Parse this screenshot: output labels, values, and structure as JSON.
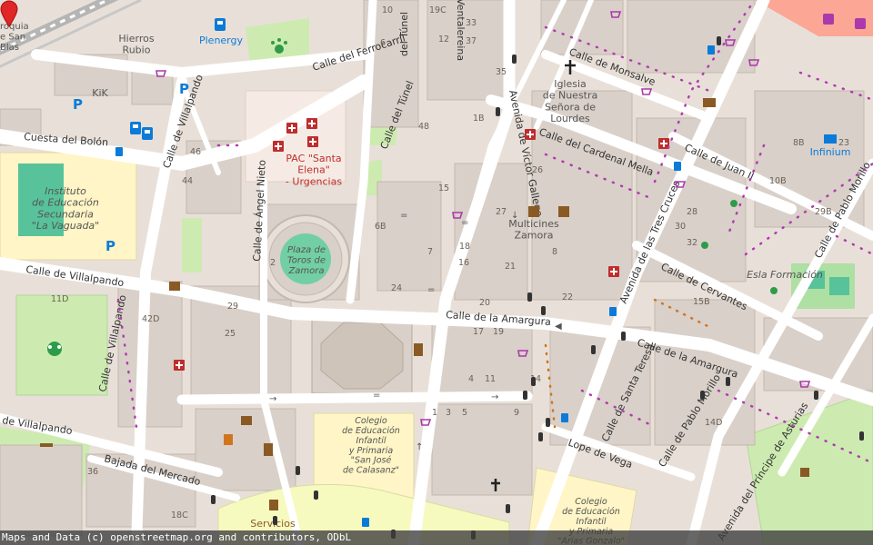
{
  "map": {
    "attribution": "Maps and Data (c) openstreetmap.org and contributors, ODbL",
    "colors": {
      "land": "#e8e0d8",
      "road": "#ffffff",
      "road_edge": "#d6cfc6",
      "building": "#d9d0c9",
      "building_edge": "#c4b8ad",
      "school": "#fff5c6",
      "park": "#cdebb0",
      "green_field": "#aedfa3",
      "bullring": "#72cfa3",
      "hospital": "#f4e8e8",
      "railway": "#ff9b8a",
      "primary_road": "#f7fabf",
      "label": "#333333",
      "poi_blue": "#0a7bd8",
      "poi_red": "#bf2d2d",
      "poi_brown": "#8a5a25",
      "marker": "#e02626"
    },
    "street_labels": [
      {
        "name": "street-cuesta-del-bolon",
        "text": "Cuesta del Bolón"
      },
      {
        "name": "street-calle-de-villalpando-1",
        "text": "Calle de Villalpando"
      },
      {
        "name": "street-calle-de-villalpando-2",
        "text": "Calle de Villalpando"
      },
      {
        "name": "street-calle-de-villalpando-3",
        "text": "Calle de Villalpando"
      },
      {
        "name": "street-calle-de-villalpando-4",
        "text": "de Villalpando"
      },
      {
        "name": "street-calle-del-ferrocarril",
        "text": "Calle del Ferrocarril"
      },
      {
        "name": "street-calle-del-tunel-1",
        "text": "Calle del Túnel"
      },
      {
        "name": "street-calle-del-tunel-2",
        "text": "del Túnel"
      },
      {
        "name": "street-calle-angel-nieto",
        "text": "Calle de Ángel Nieto"
      },
      {
        "name": "street-avenida-victor-gallego",
        "text": "Avenida de Víctor Gallego"
      },
      {
        "name": "street-calle-monsalve",
        "text": "Calle de Monsalve"
      },
      {
        "name": "street-calle-cardenal-mella",
        "text": "Calle del Cardenal Mella"
      },
      {
        "name": "street-calle-juan-ii",
        "text": "Calle de Juan II"
      },
      {
        "name": "street-avenida-tres-cruces",
        "text": "Avenida de las Tres Cruces"
      },
      {
        "name": "street-calle-cervantes",
        "text": "Calle de Cervantes"
      },
      {
        "name": "street-calle-pablo-morillo-1",
        "text": "Calle de Pablo Morillo"
      },
      {
        "name": "street-calle-pablo-morillo-2",
        "text": "Calle de Pablo Morillo"
      },
      {
        "name": "street-calle-amargura-1",
        "text": "Calle de la Amargura"
      },
      {
        "name": "street-calle-amargura-2",
        "text": "Calle de la Amargura"
      },
      {
        "name": "street-calle-santa-teresa",
        "text": "Calle de Santa Teresa"
      },
      {
        "name": "street-lope-de-vega",
        "text": "Lope de Vega"
      },
      {
        "name": "street-bajada-del-mercado",
        "text": "Bajada del Mercado"
      },
      {
        "name": "street-avenida-principe-asturias",
        "text": "Avenida del Príncipe de Asturias"
      },
      {
        "name": "street-ventalereina",
        "text": "Ventalereina"
      }
    ],
    "poi_labels": [
      {
        "name": "poi-hierros-rubio",
        "text": "Hierros\nRubio"
      },
      {
        "name": "poi-plenergy",
        "text": "Plenergy"
      },
      {
        "name": "poi-kik",
        "text": "KiK"
      },
      {
        "name": "poi-pac-santa-elena",
        "text": "PAC \"Santa\nElena\"\n- Urgencias"
      },
      {
        "name": "poi-instituto",
        "text": "Instituto\nde Educación\nSecundaria\n\"La Vaguada\""
      },
      {
        "name": "poi-plaza-toros",
        "text": "Plaza de\nToros de\nZamora"
      },
      {
        "name": "poi-iglesia",
        "text": "Iglesia\nde Nuestra\nSeñora de\nLourdes"
      },
      {
        "name": "poi-multicines",
        "text": "Multicines\nZamora"
      },
      {
        "name": "poi-infinium",
        "text": "Infinium"
      },
      {
        "name": "poi-esla-formacion",
        "text": "Esla Formación"
      },
      {
        "name": "poi-colegio-san-jose",
        "text": "Colegio\nde Educación\nInfantil\ny Primaria\n\"San José\nde Calasanz\""
      },
      {
        "name": "poi-colegio-arias",
        "text": "Colegio\nde Educación\nInfantil\ny Primaria\n\"Arias Gonzalo\""
      },
      {
        "name": "poi-servicios",
        "text": "Servicios"
      },
      {
        "name": "poi-roquia",
        "text": "roquia\ne San\nBlas"
      }
    ],
    "house_numbers": [
      {
        "name": "hn-19c",
        "text": "19C"
      },
      {
        "name": "hn-10",
        "text": "10"
      },
      {
        "name": "hn-33",
        "text": "33"
      },
      {
        "name": "hn-6",
        "text": "6"
      },
      {
        "name": "hn-12",
        "text": "12"
      },
      {
        "name": "hn-37",
        "text": "37"
      },
      {
        "name": "hn-35",
        "text": "35"
      },
      {
        "name": "hn-48",
        "text": "48"
      },
      {
        "name": "hn-1b",
        "text": "1B"
      },
      {
        "name": "hn-15",
        "text": "15"
      },
      {
        "name": "hn-27",
        "text": "27"
      },
      {
        "name": "hn-26",
        "text": "26"
      },
      {
        "name": "hn-18",
        "text": "18"
      },
      {
        "name": "hn-16",
        "text": "16"
      },
      {
        "name": "hn-21",
        "text": "21"
      },
      {
        "name": "hn-20",
        "text": "20"
      },
      {
        "name": "hn-6b",
        "text": "6B"
      },
      {
        "name": "hn-24",
        "text": "24"
      },
      {
        "name": "hn-2",
        "text": "2"
      },
      {
        "name": "hn-46",
        "text": "46"
      },
      {
        "name": "hn-44",
        "text": "44"
      },
      {
        "name": "hn-11d",
        "text": "11D"
      },
      {
        "name": "hn-42d",
        "text": "42D"
      },
      {
        "name": "hn-29",
        "text": "29"
      },
      {
        "name": "hn-25",
        "text": "25"
      },
      {
        "name": "hn-17",
        "text": "17"
      },
      {
        "name": "hn-19",
        "text": "19"
      },
      {
        "name": "hn-11",
        "text": "11"
      },
      {
        "name": "hn-9",
        "text": "9"
      },
      {
        "name": "hn-5",
        "text": "5"
      },
      {
        "name": "hn-3",
        "text": "3"
      },
      {
        "name": "hn-1",
        "text": "1"
      },
      {
        "name": "hn-4",
        "text": "4"
      },
      {
        "name": "hn-8",
        "text": "8"
      },
      {
        "name": "hn-14",
        "text": "14"
      },
      {
        "name": "hn-22",
        "text": "22"
      },
      {
        "name": "hn-36",
        "text": "36"
      },
      {
        "name": "hn-18c",
        "text": "18C"
      },
      {
        "name": "hn-8b",
        "text": "8B"
      },
      {
        "name": "hn-10b",
        "text": "10B"
      },
      {
        "name": "hn-29b",
        "text": "29B"
      },
      {
        "name": "hn-23",
        "text": "23"
      },
      {
        "name": "hn-15b",
        "text": "15B"
      },
      {
        "name": "hn-14d",
        "text": "14D"
      },
      {
        "name": "hn-28",
        "text": "28"
      },
      {
        "name": "hn-30",
        "text": "30"
      },
      {
        "name": "hn-32",
        "text": "32"
      },
      {
        "name": "hn-7",
        "text": "7"
      }
    ]
  }
}
